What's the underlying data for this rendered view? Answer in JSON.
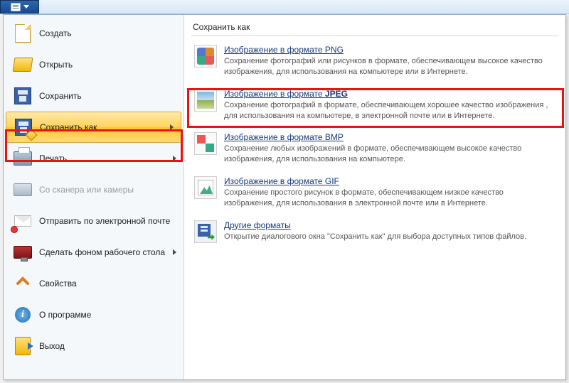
{
  "menu": {
    "new": "Создать",
    "open": "Открыть",
    "save": "Сохранить",
    "saveas_pre": "Сохранить ",
    "saveas_u": "к",
    "saveas_post": "ак",
    "print": "Печать",
    "scanner": "Со сканера или камеры",
    "email": "Отправить по электронной почте",
    "wallpaper": "Сделать фоном рабочего стола",
    "props": "Свойства",
    "about": "О программе",
    "exit": "Выход"
  },
  "right": {
    "title": "Сохранить как",
    "png": {
      "title_pre": "Изобра",
      "title_u": "ж",
      "title_post": "ение в формате PNG",
      "desc": "Сохранение фотографий или рисунков в формате, обеспечивающем высокое качество изображения, для использования на компьютере или в Интернете."
    },
    "jpeg": {
      "title_pre": "Изобр",
      "title_u": "а",
      "title_mid": "жение в формате ",
      "title_bold": "JPEG",
      "desc": "Сохранение фотографий в формате, обеспечивающем хорошее качество изображения , для использования на компьютере, в электронной почте или в Интернете."
    },
    "bmp": {
      "title": "Изображение в формате BMP",
      "desc": "Сохранение любых изображений в формате, обеспечивающем высокое качество изображения, для использования на компьютере."
    },
    "gif": {
      "title": "Изображение в формате GIF",
      "desc": "Сохранение простого рисунок в формате, обеспечивающем низкое качество изображения, для использования в электронной почте или в Интернете."
    },
    "other": {
      "title": "Другие форматы",
      "desc": "Открытие диалогового окна \"Сохранить как\" для выбора доступных типов файлов."
    }
  }
}
